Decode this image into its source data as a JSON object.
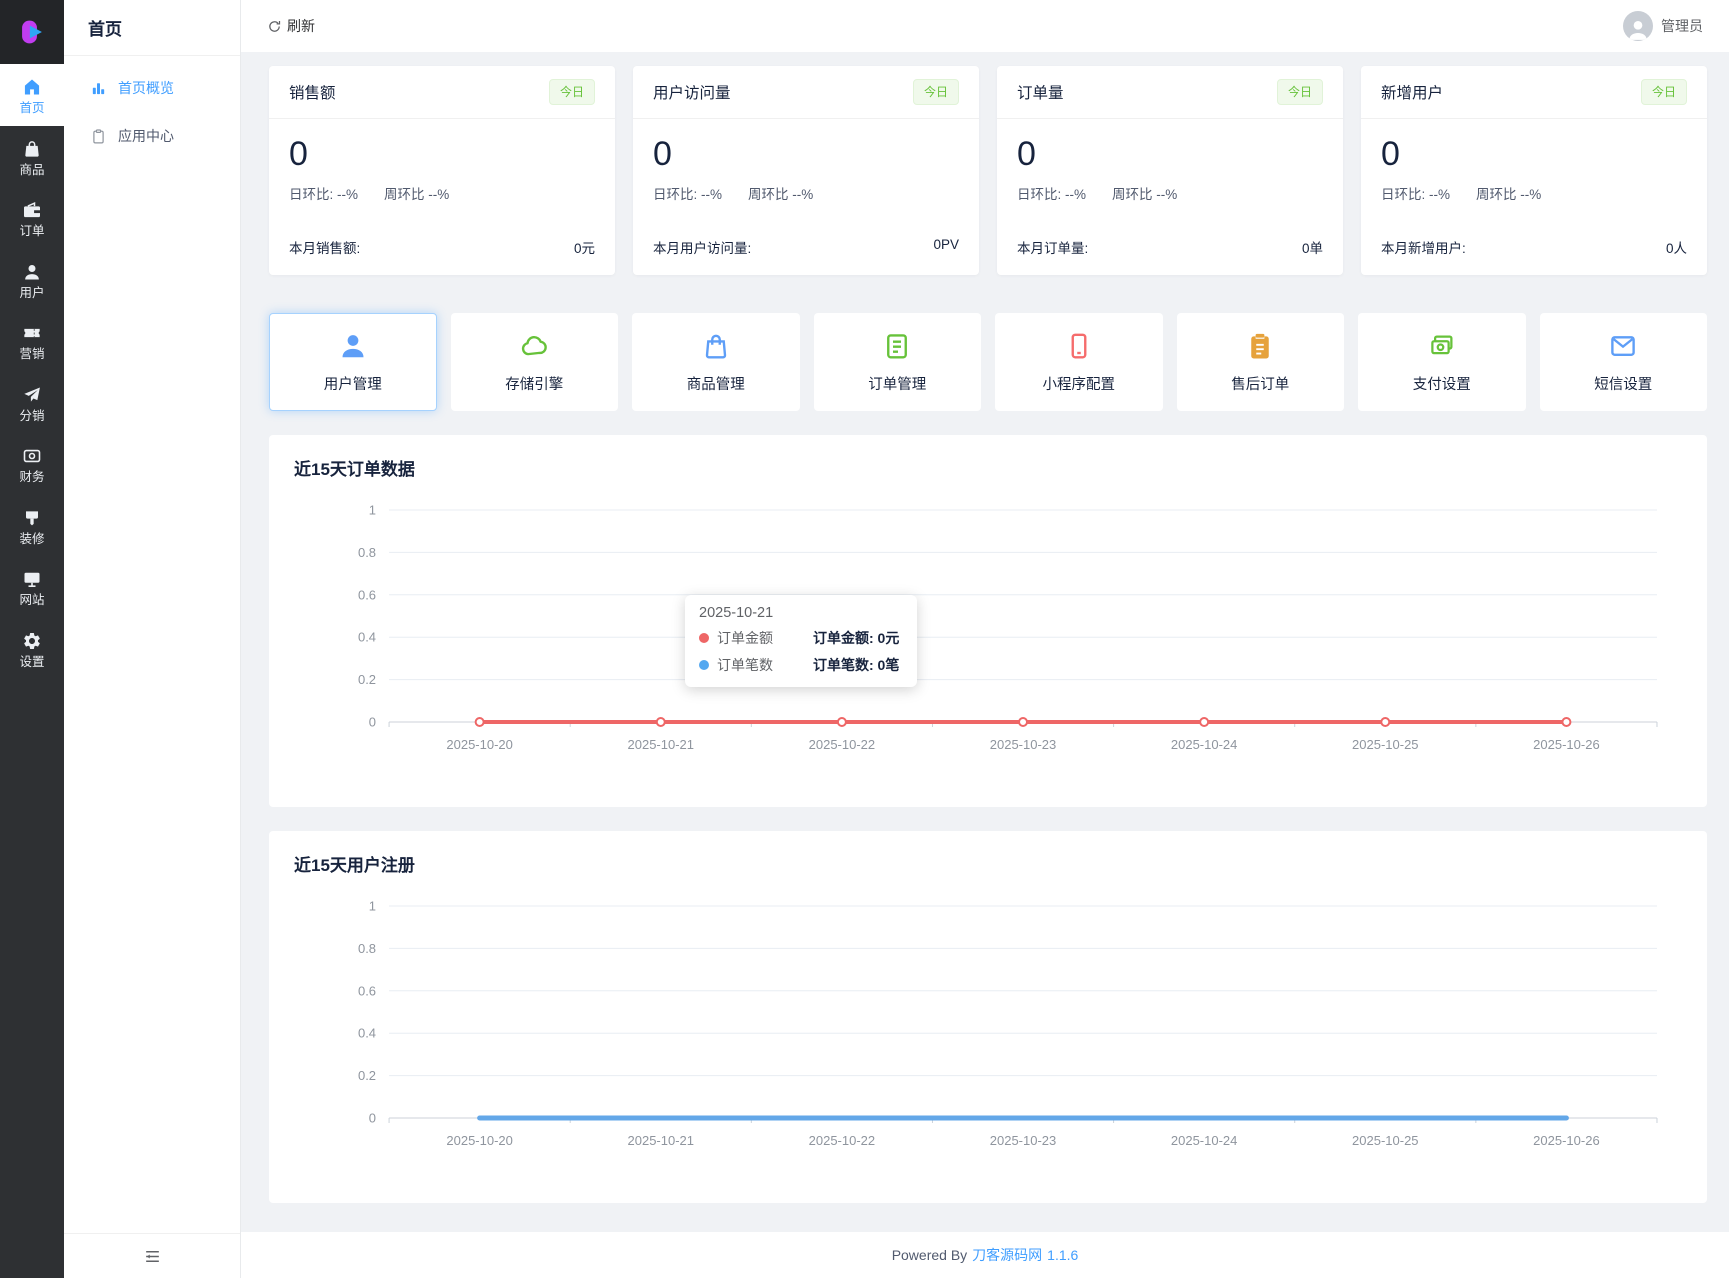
{
  "topbar": {
    "refresh_label": "刷新",
    "user_name": "管理员"
  },
  "rail": {
    "items": [
      {
        "label": "首页",
        "icon": "home",
        "active": true
      },
      {
        "label": "商品",
        "icon": "goods-bag",
        "active": false
      },
      {
        "label": "订单",
        "icon": "orders-briefcase",
        "active": false
      },
      {
        "label": "用户",
        "icon": "user",
        "active": false
      },
      {
        "label": "营销",
        "icon": "marketing-ticket",
        "active": false
      },
      {
        "label": "分销",
        "icon": "distribution-plane",
        "active": false
      },
      {
        "label": "财务",
        "icon": "finance-money",
        "active": false
      },
      {
        "label": "装修",
        "icon": "decorate-paint",
        "active": false
      },
      {
        "label": "网站",
        "icon": "website-monitor",
        "active": false
      },
      {
        "label": "设置",
        "icon": "settings-gear",
        "active": false
      }
    ]
  },
  "submenu": {
    "title": "首页",
    "items": [
      {
        "label": "首页概览",
        "icon": "overview-chart",
        "active": true
      },
      {
        "label": "应用中心",
        "icon": "app-center",
        "active": false
      }
    ]
  },
  "stats": [
    {
      "title": "销售额",
      "badge": "今日",
      "value": "0",
      "day_ratio": "日环比: --%",
      "week_ratio": "周环比 --%",
      "month_label": "本月销售额:",
      "month_value": "0元"
    },
    {
      "title": "用户访问量",
      "badge": "今日",
      "value": "0",
      "day_ratio": "日环比: --%",
      "week_ratio": "周环比 --%",
      "month_label": "本月用户访问量:",
      "month_value": "0PV"
    },
    {
      "title": "订单量",
      "badge": "今日",
      "value": "0",
      "day_ratio": "日环比: --%",
      "week_ratio": "周环比 --%",
      "month_label": "本月订单量:",
      "month_value": "0单"
    },
    {
      "title": "新增用户",
      "badge": "今日",
      "value": "0",
      "day_ratio": "日环比: --%",
      "week_ratio": "周环比 --%",
      "month_label": "本月新增用户:",
      "month_value": "0人"
    }
  ],
  "shortcuts": [
    {
      "label": "用户管理",
      "icon": "user-fill",
      "color": "#5e9ef7",
      "highlighted": true
    },
    {
      "label": "存储引擎",
      "icon": "cloud",
      "color": "#67c23a",
      "highlighted": false
    },
    {
      "label": "商品管理",
      "icon": "bag-outline",
      "color": "#5e9ef7",
      "highlighted": false
    },
    {
      "label": "订单管理",
      "icon": "doc-outline",
      "color": "#67c23a",
      "highlighted": false
    },
    {
      "label": "小程序配置",
      "icon": "phone-outline",
      "color": "#f56c6c",
      "highlighted": false
    },
    {
      "label": "售后订单",
      "icon": "clipboard-fill",
      "color": "#e6a23c",
      "highlighted": false
    },
    {
      "label": "支付设置",
      "icon": "banknotes",
      "color": "#67c23a",
      "highlighted": false
    },
    {
      "label": "短信设置",
      "icon": "mail",
      "color": "#5e9ef7",
      "highlighted": false
    }
  ],
  "chart_data": [
    {
      "type": "line",
      "title": "近15天订单数据",
      "categories": [
        "2025-10-20",
        "2025-10-21",
        "2025-10-22",
        "2025-10-23",
        "2025-10-24",
        "2025-10-25",
        "2025-10-26"
      ],
      "series": [
        {
          "name": "订单金额",
          "values": [
            0,
            0,
            0,
            0,
            0,
            0,
            0
          ],
          "color": "#ee6666",
          "width": 4,
          "markers": true
        },
        {
          "name": "订单笔数",
          "values": [
            0,
            0,
            0,
            0,
            0,
            0,
            0
          ],
          "color": "#54a8f0",
          "width": 4,
          "markers": false
        }
      ],
      "ylim": [
        0,
        1
      ],
      "yticks": [
        0,
        0.2,
        0.4,
        0.6,
        0.8,
        1
      ],
      "grid": true,
      "legend": false,
      "tooltip": {
        "date": "2025-10-21",
        "rows": [
          {
            "name": "订单金额",
            "color": "#ee6666",
            "value_text": "订单金额: 0元"
          },
          {
            "name": "订单笔数",
            "color": "#54a8f0",
            "value_text": "订单笔数: 0笔"
          }
        ]
      }
    },
    {
      "type": "line",
      "title": "近15天用户注册",
      "categories": [
        "2025-10-20",
        "2025-10-21",
        "2025-10-22",
        "2025-10-23",
        "2025-10-24",
        "2025-10-25",
        "2025-10-26"
      ],
      "series": [
        {
          "name": "",
          "values": [
            0,
            0,
            0,
            0,
            0,
            0,
            0
          ],
          "color": "#63a7e8",
          "width": 5,
          "markers": false
        }
      ],
      "ylim": [
        0,
        1
      ],
      "yticks": [
        0,
        0.2,
        0.4,
        0.6,
        0.8,
        1
      ],
      "grid": true,
      "legend": false
    }
  ],
  "footer": {
    "powered_prefix": "Powered By",
    "brand": "刀客源码网",
    "version": "1.1.6"
  },
  "colors": {
    "accent": "#409eff",
    "badge_green": "#67c23a",
    "order_line": "#ee6666",
    "register_line": "#63a7e8",
    "rail_bg": "#2e3033"
  }
}
